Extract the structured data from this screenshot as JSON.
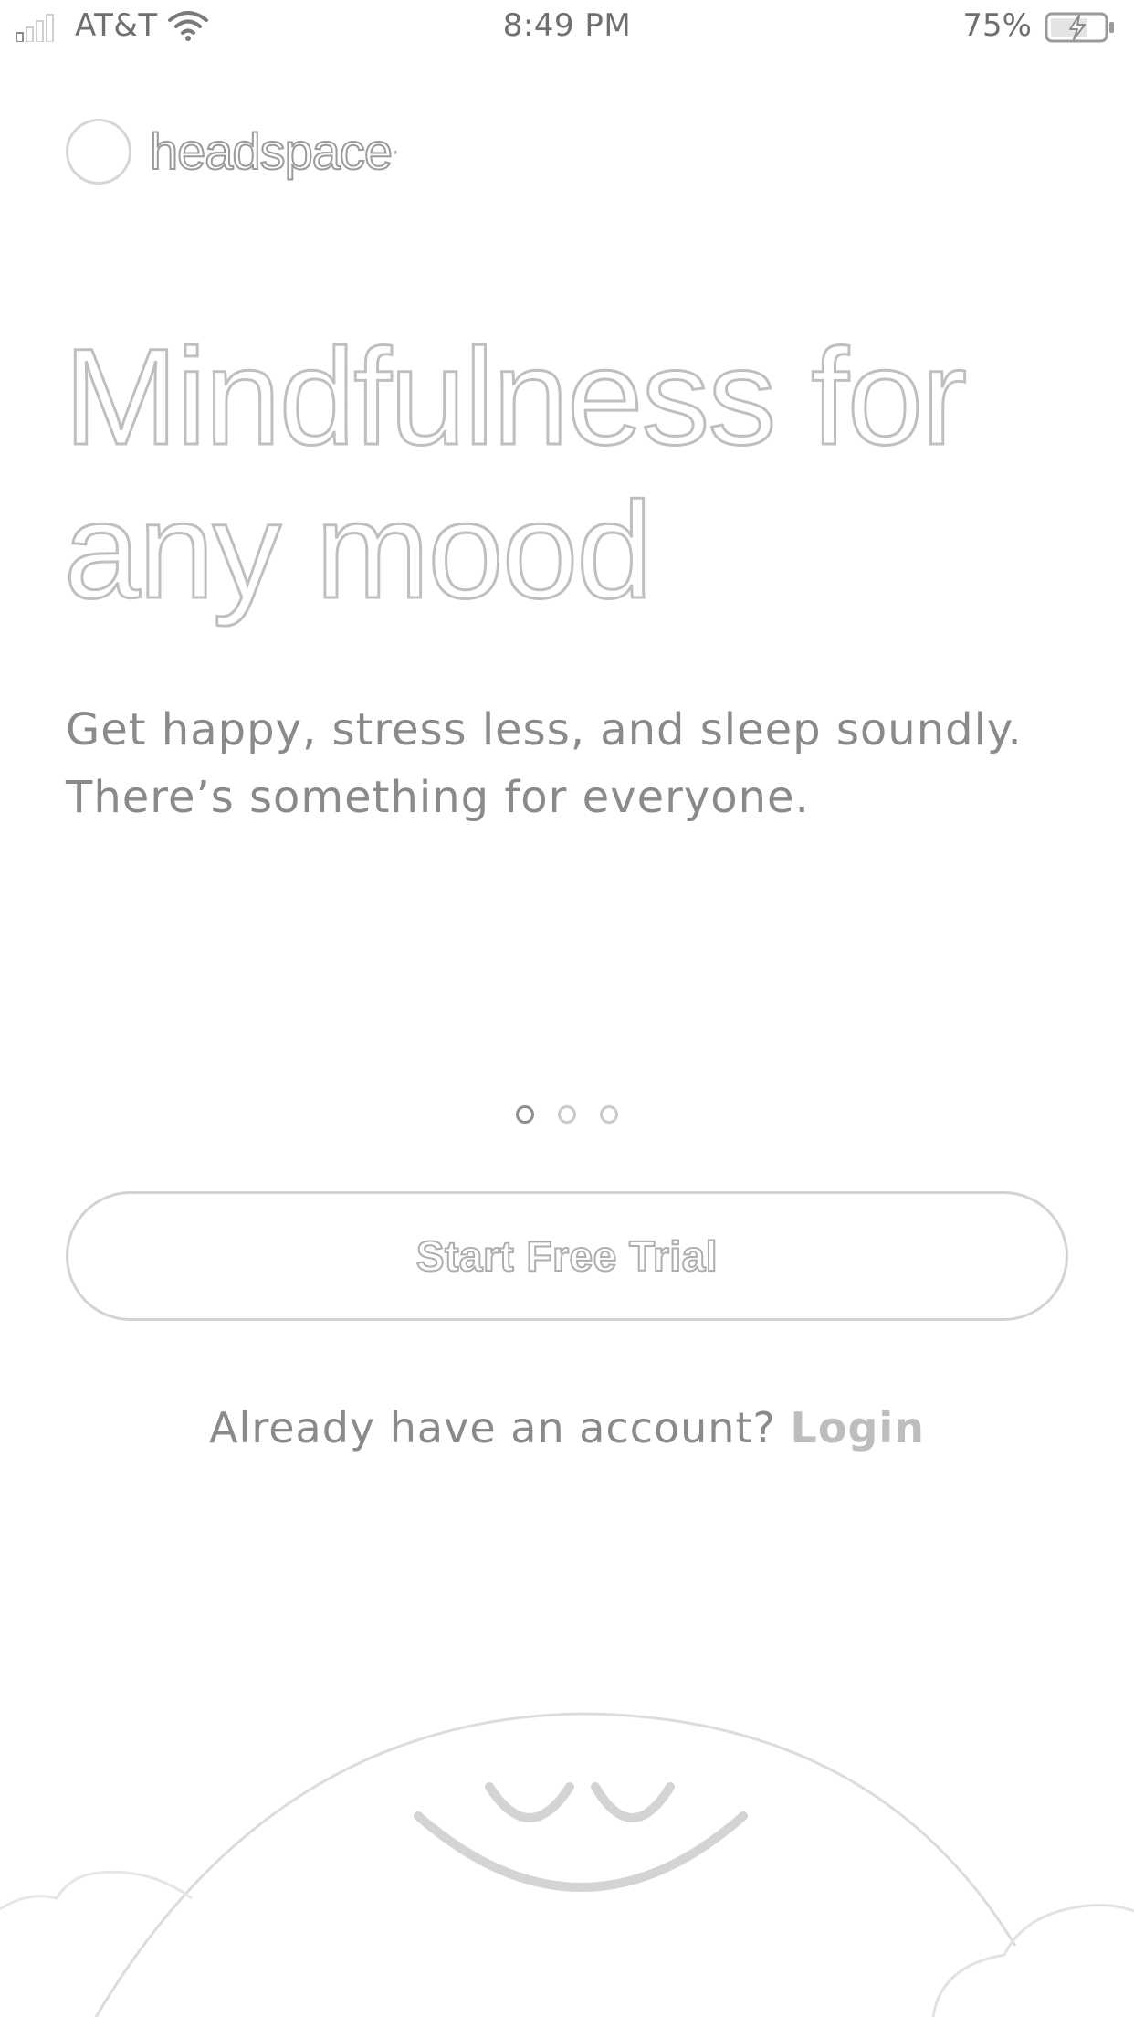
{
  "status_bar": {
    "carrier": "AT&T",
    "time": "8:49 PM",
    "battery_percent": "75%"
  },
  "brand": {
    "name": "headspace"
  },
  "hero": {
    "headline_line1": "Mindfulness for",
    "headline_line2": "any mood",
    "subtitle_line1": "Get happy, stress less, and sleep soundly.",
    "subtitle_line2": "There’s something for everyone."
  },
  "pager": {
    "count": 3,
    "active_index": 0
  },
  "cta": {
    "label": "Start Free Trial"
  },
  "login": {
    "prompt": "Already have an account?",
    "link_label": "Login"
  },
  "colors": {
    "outline_text": "#bfbfbf",
    "body_text": "#8a8a8a",
    "border": "#d3d3d3"
  }
}
